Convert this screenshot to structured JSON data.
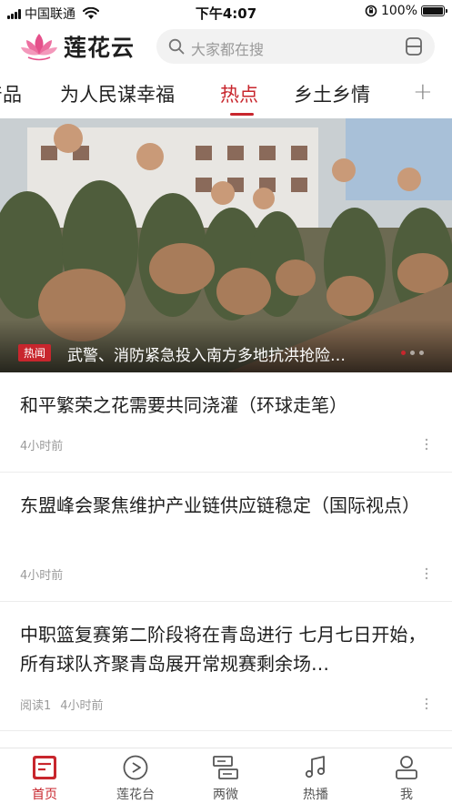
{
  "status_bar": {
    "carrier": "中国联通",
    "time": "下午4:07",
    "battery": "100%"
  },
  "header": {
    "app_name": "莲花云",
    "search_placeholder": "大家都在搜"
  },
  "tabs": [
    {
      "label": "产品"
    },
    {
      "label": "为人民谋幸福"
    },
    {
      "label": "热点",
      "active": true
    },
    {
      "label": "乡土乡情"
    }
  ],
  "hero": {
    "badge": "热闻",
    "title": "武警、消防紧急投入南方多地抗洪抢险…"
  },
  "news": [
    {
      "title": "和平繁荣之花需要共同浇灌（环球走笔）",
      "time": "4小时前"
    },
    {
      "title": "东盟峰会聚焦维护产业链供应链稳定（国际视点）",
      "time": "4小时前"
    },
    {
      "title": "中职篮复赛第二阶段将在青岛进行 七月七日开始，所有球队齐聚青岛展开常规赛剩余场…",
      "reads": "阅读1",
      "time": "4小时前"
    }
  ],
  "bottom_nav": [
    {
      "label": "首页",
      "icon": "home-icon",
      "active": true
    },
    {
      "label": "莲花台",
      "icon": "play-icon"
    },
    {
      "label": "两微",
      "icon": "weibo-icon"
    },
    {
      "label": "热播",
      "icon": "music-icon"
    },
    {
      "label": "我",
      "icon": "user-icon"
    }
  ],
  "colors": {
    "accent": "#c8262d"
  }
}
